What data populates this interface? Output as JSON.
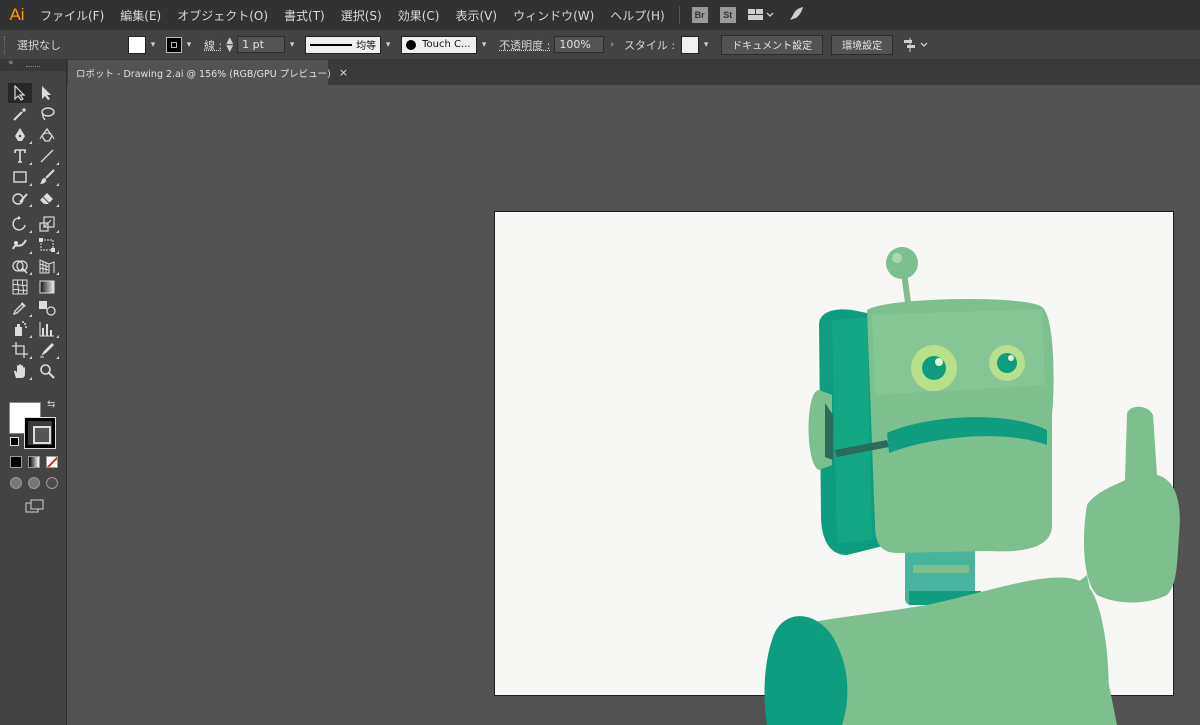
{
  "app": {
    "logo": "Ai"
  },
  "menu": {
    "items": [
      "ファイル(F)",
      "編集(E)",
      "オブジェクト(O)",
      "書式(T)",
      "選択(S)",
      "効果(C)",
      "表示(V)",
      "ウィンドウ(W)",
      "ヘルプ(H)"
    ],
    "apps": [
      "Br",
      "St"
    ]
  },
  "control_bar": {
    "selection": "選択なし",
    "stroke_label": "線 :",
    "stroke_weight": "1 pt",
    "stroke_profile": "均等",
    "brush": "Touch C...",
    "opacity_label": "不透明度 :",
    "opacity": "100%",
    "style_label": "スタイル :",
    "document_settings": "ドキュメント設定",
    "preferences": "環境設定"
  },
  "document": {
    "tab_title": "ロボット - Drawing 2.ai @ 156% (RGB/GPU プレビュー)",
    "close": "×"
  },
  "colors": {
    "fill": "#ffffff",
    "stroke": "#000000",
    "robot_light": "#7dbf8e",
    "robot_dark": "#0e9e7f",
    "robot_eye": "#b7e08a"
  },
  "tools": [
    "selection-tool",
    "direct-selection-tool",
    "magic-wand-tool",
    "lasso-tool",
    "pen-tool",
    "curvature-tool",
    "type-tool",
    "line-segment-tool",
    "rectangle-tool",
    "paintbrush-tool",
    "shaper-tool",
    "eraser-tool",
    "rotate-tool",
    "scale-tool",
    "puppet-warp-tool",
    "free-transform-tool",
    "shape-builder-tool",
    "perspective-grid-tool",
    "mesh-tool",
    "gradient-tool",
    "eyedropper-tool",
    "blend-tool",
    "symbol-sprayer-tool",
    "column-graph-tool",
    "artboard-tool",
    "slice-tool",
    "hand-tool",
    "zoom-tool"
  ]
}
